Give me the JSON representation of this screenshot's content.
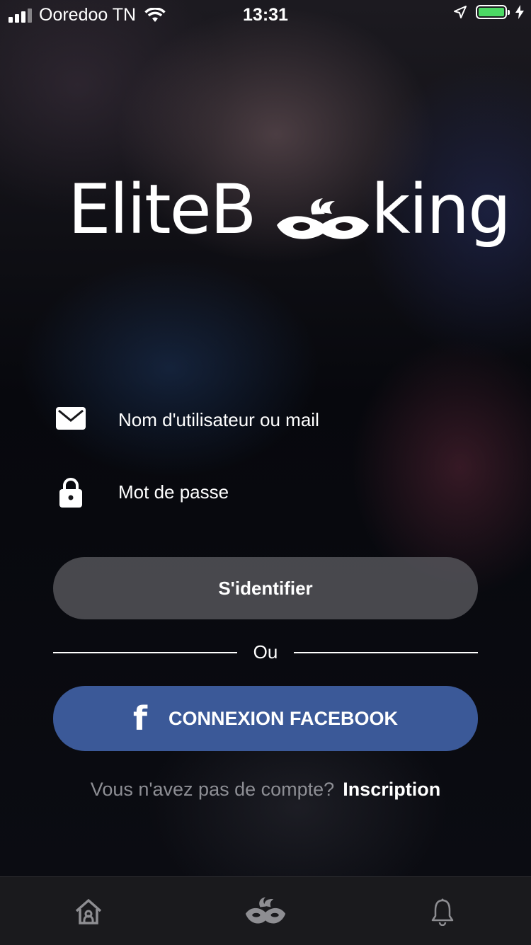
{
  "status_bar": {
    "carrier": "Ooredoo TN",
    "time": "13:31"
  },
  "logo": {
    "text_left": "EliteB",
    "text_right": "king"
  },
  "form": {
    "username_placeholder": "Nom d'utilisateur ou mail",
    "password_placeholder": "Mot de passe",
    "login_label": "S'identifier",
    "divider_label": "Ou",
    "facebook_label": "CONNEXION FACEBOOK",
    "facebook_icon": "f"
  },
  "signup": {
    "question": "Vous n'avez pas de compte?",
    "link": "Inscription"
  },
  "colors": {
    "facebook": "#3b5998",
    "battery": "#4cd964"
  },
  "tab_bar": {
    "items": [
      "home-icon",
      "mask-icon",
      "bell-icon"
    ]
  }
}
